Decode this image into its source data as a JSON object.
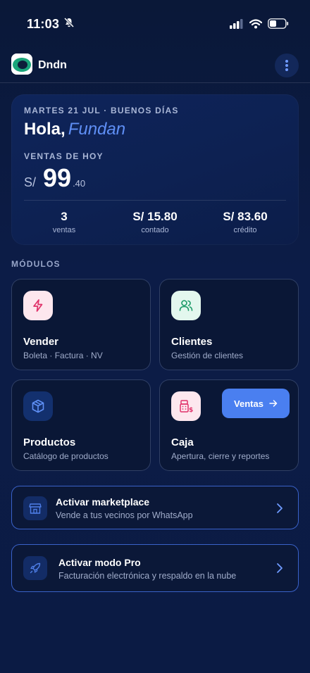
{
  "status_bar": {
    "time": "11:03"
  },
  "header": {
    "app_name": "Dndn"
  },
  "summary": {
    "date_line": "MARTES 21 JUL · BUENOS DÍAS",
    "greeting": "Hola,",
    "user_name": "Fundan",
    "sales_label": "VENTAS DE HOY",
    "currency": "S/",
    "amount_int": "99",
    "amount_dec": ".40",
    "stats": [
      {
        "value": "3",
        "label": "ventas"
      },
      {
        "value": "S/ 15.80",
        "label": "contado"
      },
      {
        "value": "S/ 83.60",
        "label": "crédito"
      }
    ]
  },
  "modules_label": "MÓDULOS",
  "modules": [
    {
      "title": "Vender",
      "subtitle": "Boleta · Factura · NV",
      "icon": "lightning-icon"
    },
    {
      "title": "Clientes",
      "subtitle": "Gestión de clientes",
      "icon": "users-icon"
    },
    {
      "title": "Productos",
      "subtitle": "Catálogo de productos",
      "icon": "box-icon"
    },
    {
      "title": "Caja",
      "subtitle": "Apertura, cierre y reportes",
      "icon": "cash-register-icon",
      "button_label": "Ventas"
    }
  ],
  "actions": [
    {
      "title": "Activar marketplace",
      "subtitle": "Vende a tus vecinos por WhatsApp",
      "icon": "store-icon"
    },
    {
      "title": "Activar modo Pro",
      "subtitle": "Facturación electrónica y respaldo en la nube",
      "icon": "rocket-icon"
    }
  ],
  "colors": {
    "background": "#0b1a3f",
    "accent": "#4a7ff0",
    "name_accent": "#5f8ff5",
    "action_border": "#3a62c9"
  }
}
